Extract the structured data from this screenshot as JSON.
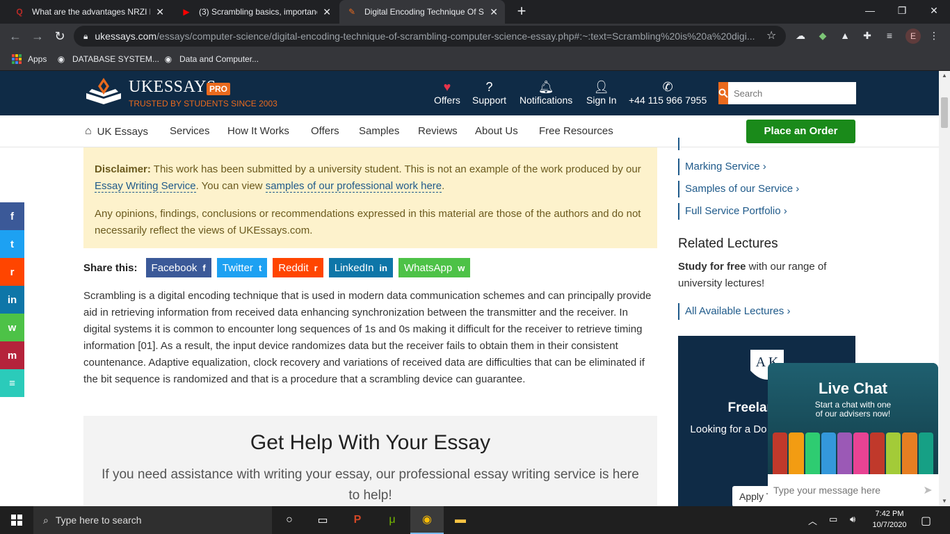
{
  "browser": {
    "tabs": [
      {
        "title": "What are the advantages NRZI ha",
        "favicon": "Q",
        "favicon_color": "#b92b27",
        "active": false
      },
      {
        "title": "(3) Scrambling basics, importance",
        "favicon": "▶",
        "favicon_color": "#ff0000",
        "active": false
      },
      {
        "title": "Digital Encoding Technique Of Sc",
        "favicon": "✎",
        "favicon_color": "#ea6a1d",
        "active": true
      }
    ],
    "url_host": "ukessays.com",
    "url_path": "/essays/computer-science/digital-encoding-technique-of-scrambling-computer-science-essay.php#:~:text=Scrambling%20is%20a%20digi...",
    "profile_initial": "E",
    "bookmarks": [
      {
        "label": "Apps"
      },
      {
        "label": "DATABASE SYSTEM..."
      },
      {
        "label": "Data and Computer..."
      }
    ]
  },
  "site_header": {
    "brand": "UKESSAYS",
    "badge": "PRO",
    "tagline": "TRUSTED BY STUDENTS SINCE 2003",
    "nav": [
      {
        "label": "Offers",
        "icon": "heart-icon"
      },
      {
        "label": "Support",
        "icon": "help-icon"
      },
      {
        "label": "Notifications",
        "icon": "bell-icon"
      },
      {
        "label": "Sign In",
        "icon": "user-icon"
      }
    ],
    "phone": "+44 115 966 7955",
    "search_placeholder": "Search",
    "colors": {
      "navy": "#0f2b46",
      "orange": "#ea6a1d",
      "green": "#1a8a1a"
    }
  },
  "main_nav": {
    "items": [
      "UK Essays",
      "Services",
      "How It Works",
      "Offers",
      "Samples",
      "Reviews",
      "About Us",
      "Free Resources"
    ],
    "order_button": "Place an Order"
  },
  "disclaimer": {
    "label": "Disclaimer:",
    "text1": "This work has been submitted by a university student. This is not an example of the work produced by our",
    "link1": "Essay Writing Service",
    "text2": ". You can view",
    "link2": "samples of our professional work here",
    "text3": ".",
    "para2": "Any opinions, findings, conclusions or recommendations expressed in this material are those of the authors and do not necessarily reflect the views of UKEssays.com."
  },
  "share": {
    "label": "Share this:",
    "buttons": [
      {
        "label": "Facebook",
        "glyph": "f",
        "color": "#3b5998"
      },
      {
        "label": "Twitter",
        "glyph": "t",
        "color": "#1da1f2"
      },
      {
        "label": "Reddit",
        "glyph": "r",
        "color": "#ff4500"
      },
      {
        "label": "LinkedIn",
        "glyph": "in",
        "color": "#0e76a8"
      },
      {
        "label": "WhatsApp",
        "glyph": "w",
        "color": "#4dc247"
      }
    ]
  },
  "essay": {
    "paragraph": "Scrambling is a digital encoding technique that is used in modern data communication schemes and can principally provide aid in retrieving information from received data enhancing synchronization between the transmitter and the receiver. In digital systems it is common to encounter long sequences of 1s and 0s making it difficult for the receiver to retrieve timing information [01]. As a result, the input device randomizes data but the receiver fails to obtain them in their consistent countenance. Adaptive equalization, clock recovery and variations of received data are difficulties that can be eliminated if the bit sequence is randomized and that is a procedure that a scrambling device can guarantee."
  },
  "get_help": {
    "title": "Get Help With Your Essay",
    "text": "If you need assistance with writing your essay, our professional essay writing service is here to help!"
  },
  "sidebar": {
    "links": [
      "Marking Service",
      "Samples of our Service",
      "Full Service Portfolio"
    ],
    "related_title": "Related Lectures",
    "related_bold": "Study for free",
    "related_text": " with our range of university lectures!",
    "all_lectures": "All Available Lectures",
    "freelance_title": "Freelance W",
    "freelance_text": "Looking for a Do you have a high",
    "apply_label": "Apply T"
  },
  "live_chat": {
    "title": "Live Chat",
    "subtitle_1": "Start a chat with one",
    "subtitle_2": "of our advisers now!",
    "input_placeholder": "Type your message here"
  },
  "social_rail": [
    {
      "glyph": "f",
      "color": "#3b5998",
      "icon": "facebook-icon"
    },
    {
      "glyph": "t",
      "color": "#1da1f2",
      "icon": "twitter-icon"
    },
    {
      "glyph": "r",
      "color": "#ff4500",
      "icon": "reddit-icon"
    },
    {
      "glyph": "in",
      "color": "#0e76a8",
      "icon": "linkedin-icon"
    },
    {
      "glyph": "w",
      "color": "#4dc247",
      "icon": "whatsapp-icon"
    },
    {
      "glyph": "m",
      "color": "#b5233b",
      "icon": "mendeley-icon"
    },
    {
      "glyph": "≡",
      "color": "#2bcbba",
      "icon": "bookmark-icon"
    }
  ],
  "taskbar": {
    "search_placeholder": "Type here to search",
    "time": "7:42 PM",
    "date": "10/7/2020"
  }
}
